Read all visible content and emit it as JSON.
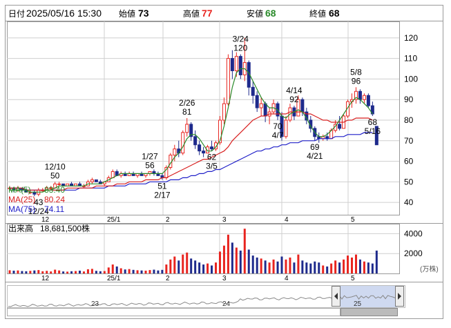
{
  "header": {
    "date_label": "日付",
    "date_value": "2025/05/16 15:30",
    "open_label": "始値",
    "open_value": "73",
    "high_label": "高値",
    "high_value": "77",
    "low_label": "安値",
    "low_value": "68",
    "close_label": "終値",
    "close_value": "68"
  },
  "legend": {
    "ma5_label": "MA(5)",
    "ma5_value": "83.40",
    "ma25_label": "MA(25)",
    "ma25_value": "80.24",
    "ma75_label": "MA(75)",
    "ma75_value": "74.11"
  },
  "volume_panel": {
    "title": "出来高",
    "total": "18,681,500株",
    "unit_label": "(万株)"
  },
  "colors": {
    "up": "#e8241f",
    "down": "#1e2a8c",
    "ma5": "#2a8a2a",
    "ma25": "#d81e1e",
    "ma75": "#1e1ec8",
    "grid": "#cfcfcf",
    "overview_fill": "#cfd9f0"
  },
  "chart_data": {
    "type": "candlestick",
    "price_axis_ticks": [
      "40",
      "50",
      "60",
      "70",
      "80",
      "90",
      "100",
      "110",
      "120"
    ],
    "price_range": [
      34,
      128
    ],
    "month_labels": [
      "12",
      "25/1",
      "2",
      "3",
      "4",
      "5"
    ],
    "volume_axis_ticks": [
      "2000",
      "4000"
    ],
    "volume_range": [
      0,
      5000
    ],
    "overview_labels": [
      "23",
      "24",
      "25"
    ],
    "annotations": [
      {
        "date": "12/10",
        "value": "50"
      },
      {
        "date": "12/24",
        "value": "43"
      },
      {
        "date": "1/27",
        "value": "56"
      },
      {
        "date": "2/17",
        "value": "51"
      },
      {
        "date": "2/26",
        "value": "81"
      },
      {
        "date": "3/5",
        "value": "62"
      },
      {
        "date": "3/24",
        "value": "120"
      },
      {
        "date": "4/7",
        "value": "70"
      },
      {
        "date": "4/14",
        "value": "92"
      },
      {
        "date": "4/21",
        "value": "69"
      },
      {
        "date": "5/8",
        "value": "96"
      },
      {
        "date": "5/16",
        "value": "68"
      }
    ],
    "candles": [
      {
        "o": 47,
        "h": 48,
        "l": 46,
        "c": 47,
        "v": 320
      },
      {
        "o": 47,
        "h": 47,
        "l": 45,
        "c": 46,
        "v": 280
      },
      {
        "o": 46,
        "h": 48,
        "l": 45,
        "c": 47,
        "v": 300
      },
      {
        "o": 47,
        "h": 47,
        "l": 45,
        "c": 46,
        "v": 240
      },
      {
        "o": 46,
        "h": 47,
        "l": 45,
        "c": 45,
        "v": 220
      },
      {
        "o": 45,
        "h": 46,
        "l": 44,
        "c": 45,
        "v": 260
      },
      {
        "o": 45,
        "h": 46,
        "l": 43,
        "c": 44,
        "v": 300
      },
      {
        "o": 44,
        "h": 47,
        "l": 43,
        "c": 46,
        "v": 340
      },
      {
        "o": 46,
        "h": 47,
        "l": 45,
        "c": 46,
        "v": 220
      },
      {
        "o": 46,
        "h": 48,
        "l": 46,
        "c": 47,
        "v": 260
      },
      {
        "o": 47,
        "h": 48,
        "l": 46,
        "c": 47,
        "v": 200
      },
      {
        "o": 47,
        "h": 50,
        "l": 47,
        "c": 49,
        "v": 380
      },
      {
        "o": 49,
        "h": 50,
        "l": 48,
        "c": 49,
        "v": 300
      },
      {
        "o": 49,
        "h": 49,
        "l": 48,
        "c": 48,
        "v": 200
      },
      {
        "o": 48,
        "h": 49,
        "l": 48,
        "c": 49,
        "v": 180
      },
      {
        "o": 49,
        "h": 50,
        "l": 48,
        "c": 48,
        "v": 220
      },
      {
        "o": 48,
        "h": 49,
        "l": 48,
        "c": 49,
        "v": 240
      },
      {
        "o": 49,
        "h": 50,
        "l": 48,
        "c": 48,
        "v": 280
      },
      {
        "o": 48,
        "h": 49,
        "l": 47,
        "c": 48,
        "v": 200
      },
      {
        "o": 48,
        "h": 51,
        "l": 48,
        "c": 50,
        "v": 420
      },
      {
        "o": 50,
        "h": 52,
        "l": 49,
        "c": 51,
        "v": 460
      },
      {
        "o": 51,
        "h": 51,
        "l": 50,
        "c": 50,
        "v": 260
      },
      {
        "o": 50,
        "h": 51,
        "l": 49,
        "c": 49,
        "v": 220
      },
      {
        "o": 49,
        "h": 50,
        "l": 48,
        "c": 50,
        "v": 240
      },
      {
        "o": 50,
        "h": 53,
        "l": 50,
        "c": 52,
        "v": 600
      },
      {
        "o": 52,
        "h": 56,
        "l": 52,
        "c": 55,
        "v": 900
      },
      {
        "o": 55,
        "h": 56,
        "l": 53,
        "c": 53,
        "v": 700
      },
      {
        "o": 53,
        "h": 55,
        "l": 52,
        "c": 54,
        "v": 520
      },
      {
        "o": 54,
        "h": 55,
        "l": 53,
        "c": 53,
        "v": 400
      },
      {
        "o": 53,
        "h": 55,
        "l": 53,
        "c": 54,
        "v": 440
      },
      {
        "o": 54,
        "h": 55,
        "l": 53,
        "c": 53,
        "v": 360
      },
      {
        "o": 53,
        "h": 54,
        "l": 52,
        "c": 54,
        "v": 320
      },
      {
        "o": 54,
        "h": 55,
        "l": 53,
        "c": 53,
        "v": 300
      },
      {
        "o": 53,
        "h": 54,
        "l": 52,
        "c": 54,
        "v": 280
      },
      {
        "o": 54,
        "h": 55,
        "l": 53,
        "c": 55,
        "v": 340
      },
      {
        "o": 55,
        "h": 56,
        "l": 53,
        "c": 54,
        "v": 380
      },
      {
        "o": 54,
        "h": 55,
        "l": 53,
        "c": 53,
        "v": 300
      },
      {
        "o": 53,
        "h": 54,
        "l": 51,
        "c": 52,
        "v": 360
      },
      {
        "o": 52,
        "h": 58,
        "l": 51,
        "c": 57,
        "v": 900
      },
      {
        "o": 57,
        "h": 64,
        "l": 56,
        "c": 63,
        "v": 1400
      },
      {
        "o": 63,
        "h": 68,
        "l": 60,
        "c": 66,
        "v": 1700
      },
      {
        "o": 66,
        "h": 70,
        "l": 62,
        "c": 64,
        "v": 1300
      },
      {
        "o": 64,
        "h": 75,
        "l": 63,
        "c": 74,
        "v": 1900
      },
      {
        "o": 74,
        "h": 81,
        "l": 72,
        "c": 78,
        "v": 2100
      },
      {
        "o": 78,
        "h": 79,
        "l": 70,
        "c": 72,
        "v": 1500
      },
      {
        "o": 72,
        "h": 75,
        "l": 66,
        "c": 68,
        "v": 1300
      },
      {
        "o": 68,
        "h": 70,
        "l": 63,
        "c": 65,
        "v": 1100
      },
      {
        "o": 65,
        "h": 67,
        "l": 62,
        "c": 64,
        "v": 900
      },
      {
        "o": 64,
        "h": 68,
        "l": 64,
        "c": 67,
        "v": 1000
      },
      {
        "o": 67,
        "h": 70,
        "l": 65,
        "c": 66,
        "v": 800
      },
      {
        "o": 66,
        "h": 70,
        "l": 65,
        "c": 69,
        "v": 1100
      },
      {
        "o": 69,
        "h": 82,
        "l": 68,
        "c": 80,
        "v": 2200
      },
      {
        "o": 80,
        "h": 91,
        "l": 78,
        "c": 88,
        "v": 2800
      },
      {
        "o": 88,
        "h": 112,
        "l": 87,
        "c": 110,
        "v": 3900
      },
      {
        "o": 110,
        "h": 114,
        "l": 100,
        "c": 104,
        "v": 3100
      },
      {
        "o": 104,
        "h": 113,
        "l": 101,
        "c": 111,
        "v": 2600
      },
      {
        "o": 111,
        "h": 112,
        "l": 100,
        "c": 102,
        "v": 2300
      },
      {
        "o": 102,
        "h": 120,
        "l": 99,
        "c": 108,
        "v": 4500
      },
      {
        "o": 108,
        "h": 109,
        "l": 92,
        "c": 96,
        "v": 2400
      },
      {
        "o": 96,
        "h": 99,
        "l": 88,
        "c": 92,
        "v": 1800
      },
      {
        "o": 92,
        "h": 94,
        "l": 84,
        "c": 86,
        "v": 1600
      },
      {
        "o": 86,
        "h": 91,
        "l": 82,
        "c": 88,
        "v": 1500
      },
      {
        "o": 88,
        "h": 89,
        "l": 79,
        "c": 82,
        "v": 1300
      },
      {
        "o": 82,
        "h": 86,
        "l": 78,
        "c": 84,
        "v": 1100
      },
      {
        "o": 84,
        "h": 90,
        "l": 83,
        "c": 88,
        "v": 1400
      },
      {
        "o": 88,
        "h": 89,
        "l": 80,
        "c": 82,
        "v": 1200
      },
      {
        "o": 82,
        "h": 84,
        "l": 70,
        "c": 72,
        "v": 1700
      },
      {
        "o": 72,
        "h": 82,
        "l": 71,
        "c": 80,
        "v": 1400
      },
      {
        "o": 80,
        "h": 88,
        "l": 79,
        "c": 86,
        "v": 1600
      },
      {
        "o": 86,
        "h": 87,
        "l": 80,
        "c": 82,
        "v": 1100
      },
      {
        "o": 82,
        "h": 92,
        "l": 82,
        "c": 90,
        "v": 1900
      },
      {
        "o": 90,
        "h": 91,
        "l": 82,
        "c": 84,
        "v": 1300
      },
      {
        "o": 84,
        "h": 86,
        "l": 78,
        "c": 80,
        "v": 1100
      },
      {
        "o": 80,
        "h": 82,
        "l": 74,
        "c": 76,
        "v": 1000
      },
      {
        "o": 76,
        "h": 77,
        "l": 70,
        "c": 72,
        "v": 1200
      },
      {
        "o": 72,
        "h": 74,
        "l": 69,
        "c": 71,
        "v": 1100
      },
      {
        "o": 71,
        "h": 73,
        "l": 70,
        "c": 72,
        "v": 800
      },
      {
        "o": 72,
        "h": 74,
        "l": 70,
        "c": 71,
        "v": 700
      },
      {
        "o": 71,
        "h": 76,
        "l": 71,
        "c": 75,
        "v": 1000
      },
      {
        "o": 75,
        "h": 80,
        "l": 74,
        "c": 78,
        "v": 1300
      },
      {
        "o": 78,
        "h": 82,
        "l": 75,
        "c": 76,
        "v": 1100
      },
      {
        "o": 76,
        "h": 83,
        "l": 76,
        "c": 82,
        "v": 1400
      },
      {
        "o": 82,
        "h": 90,
        "l": 81,
        "c": 89,
        "v": 1800
      },
      {
        "o": 89,
        "h": 93,
        "l": 86,
        "c": 90,
        "v": 1600
      },
      {
        "o": 90,
        "h": 96,
        "l": 88,
        "c": 94,
        "v": 1900
      },
      {
        "o": 94,
        "h": 95,
        "l": 88,
        "c": 90,
        "v": 1400
      },
      {
        "o": 90,
        "h": 93,
        "l": 88,
        "c": 92,
        "v": 1200
      },
      {
        "o": 92,
        "h": 93,
        "l": 86,
        "c": 87,
        "v": 1100
      },
      {
        "o": 87,
        "h": 89,
        "l": 82,
        "c": 83,
        "v": 1000
      },
      {
        "o": 77,
        "h": 77,
        "l": 68,
        "c": 68,
        "v": 2300
      }
    ],
    "ma5_series": [
      46,
      46,
      46,
      46,
      46,
      45,
      45,
      45,
      45,
      46,
      46,
      47,
      48,
      48,
      48,
      48,
      48,
      48,
      48,
      49,
      49,
      49,
      49,
      50,
      51,
      52,
      53,
      54,
      54,
      54,
      54,
      54,
      54,
      54,
      54,
      54,
      54,
      54,
      56,
      59,
      62,
      64,
      67,
      71,
      73,
      73,
      71,
      68,
      65,
      65,
      67,
      70,
      77,
      86,
      96,
      103,
      105,
      105,
      103,
      99,
      95,
      91,
      88,
      86,
      86,
      85,
      82,
      81,
      83,
      84,
      85,
      84,
      81,
      77,
      74,
      72,
      72,
      73,
      75,
      77,
      80,
      83,
      86,
      89,
      91,
      90,
      88,
      86,
      83
    ],
    "ma25_series": [
      47,
      47,
      47,
      47,
      46,
      46,
      46,
      46,
      46,
      46,
      46,
      46,
      46,
      46,
      47,
      47,
      47,
      47,
      47,
      47,
      47,
      48,
      48,
      48,
      48,
      48,
      49,
      49,
      49,
      50,
      50,
      50,
      50,
      51,
      51,
      51,
      51,
      52,
      52,
      53,
      54,
      55,
      56,
      57,
      58,
      59,
      60,
      61,
      61,
      62,
      63,
      64,
      65,
      67,
      70,
      72,
      74,
      76,
      78,
      80,
      81,
      82,
      82,
      83,
      83,
      83,
      83,
      83,
      84,
      84,
      84,
      84,
      83,
      83,
      82,
      81,
      80,
      80,
      79,
      79,
      79,
      79,
      80,
      80,
      81,
      81,
      81,
      81,
      80
    ],
    "ma75_series": [
      47,
      47,
      47,
      46,
      46,
      46,
      46,
      46,
      46,
      46,
      46,
      46,
      46,
      46,
      46,
      46,
      46,
      47,
      47,
      47,
      47,
      47,
      47,
      47,
      48,
      48,
      48,
      48,
      48,
      49,
      49,
      49,
      49,
      49,
      50,
      50,
      50,
      50,
      50,
      51,
      51,
      51,
      52,
      52,
      53,
      53,
      54,
      54,
      55,
      55,
      56,
      56,
      57,
      58,
      59,
      60,
      61,
      62,
      63,
      64,
      65,
      65,
      66,
      66,
      67,
      67,
      68,
      68,
      69,
      69,
      69,
      70,
      70,
      70,
      70,
      71,
      71,
      71,
      71,
      72,
      72,
      72,
      73,
      73,
      73,
      73,
      74,
      74,
      74
    ]
  }
}
